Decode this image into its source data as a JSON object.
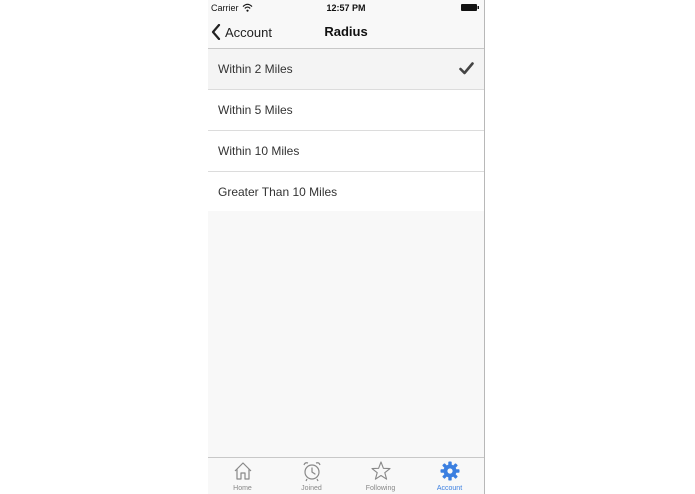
{
  "status_bar": {
    "carrier": "Carrier",
    "time": "12:57 PM"
  },
  "nav": {
    "back_label": "Account",
    "title": "Radius"
  },
  "radius_options": [
    {
      "label": "Within 2 Miles",
      "selected": true
    },
    {
      "label": "Within 5 Miles",
      "selected": false
    },
    {
      "label": "Within 10 Miles",
      "selected": false
    },
    {
      "label": "Greater Than 10 Miles",
      "selected": false
    }
  ],
  "tabs": [
    {
      "label": "Home",
      "icon": "home-icon",
      "active": false
    },
    {
      "label": "Joined",
      "icon": "alarm-clock-icon",
      "active": false
    },
    {
      "label": "Following",
      "icon": "star-icon",
      "active": false
    },
    {
      "label": "Account",
      "icon": "gear-icon",
      "active": true
    }
  ],
  "colors": {
    "accent": "#3b7fe0",
    "tab_inactive": "#888888"
  }
}
